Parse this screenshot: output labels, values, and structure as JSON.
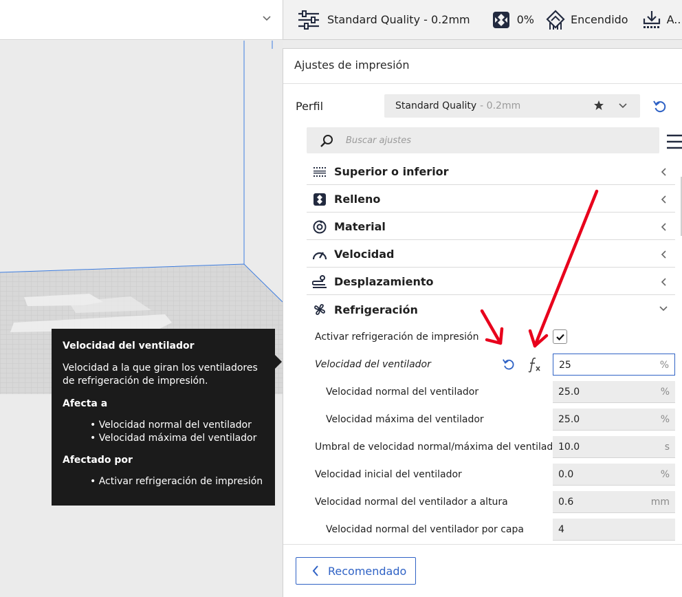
{
  "topbar": {
    "profile_label": "Standard Quality - 0.2mm",
    "infill_label": "0%",
    "support_label": "Encendido",
    "adhesion_label": "A..."
  },
  "panel": {
    "title": "Ajustes de impresión",
    "profile_label": "Perfil",
    "profile_name": "Standard Quality",
    "profile_variant": "- 0.2mm",
    "search_placeholder": "Buscar ajustes",
    "categories": [
      {
        "label": "Superior o inferior",
        "icon": "top-bottom-icon"
      },
      {
        "label": "Relleno",
        "icon": "infill-icon"
      },
      {
        "label": "Material",
        "icon": "material-icon"
      },
      {
        "label": "Velocidad",
        "icon": "speed-icon"
      },
      {
        "label": "Desplazamiento",
        "icon": "travel-icon"
      },
      {
        "label": "Refrigeración",
        "icon": "fan-icon"
      }
    ],
    "settings": [
      {
        "label": "Activar refrigeración de impresión",
        "checked": true
      },
      {
        "label": "Velocidad del ventilador",
        "value": "25",
        "unit": "%"
      },
      {
        "label": "Velocidad normal del ventilador",
        "value": "25.0",
        "unit": "%"
      },
      {
        "label": "Velocidad máxima del ventilador",
        "value": "25.0",
        "unit": "%"
      },
      {
        "label": "Umbral de velocidad normal/máxima del ventilador",
        "value": "10.0",
        "unit": "s"
      },
      {
        "label": "Velocidad inicial del ventilador",
        "value": "0.0",
        "unit": "%"
      },
      {
        "label": "Velocidad normal del ventilador a altura",
        "value": "0.6",
        "unit": "mm"
      },
      {
        "label": "Velocidad normal del ventilador por capa",
        "value": "4",
        "unit": ""
      }
    ],
    "recommended_label": "Recomendado"
  },
  "tooltip": {
    "title": "Velocidad del ventilador",
    "description": "Velocidad a la que giran los ventiladores de refrigeración de impresión.",
    "affects_heading": "Afecta a",
    "affects": [
      "• Velocidad normal del ventilador",
      "• Velocidad máxima del ventilador"
    ],
    "affected_by_heading": "Afectado por",
    "affected_by": [
      "• Activar refrigeración de impresión"
    ]
  },
  "colors": {
    "accent": "#2f62c5",
    "annotation_arrow": "#e8001c",
    "tooltip_bg": "#1b1b1b"
  }
}
